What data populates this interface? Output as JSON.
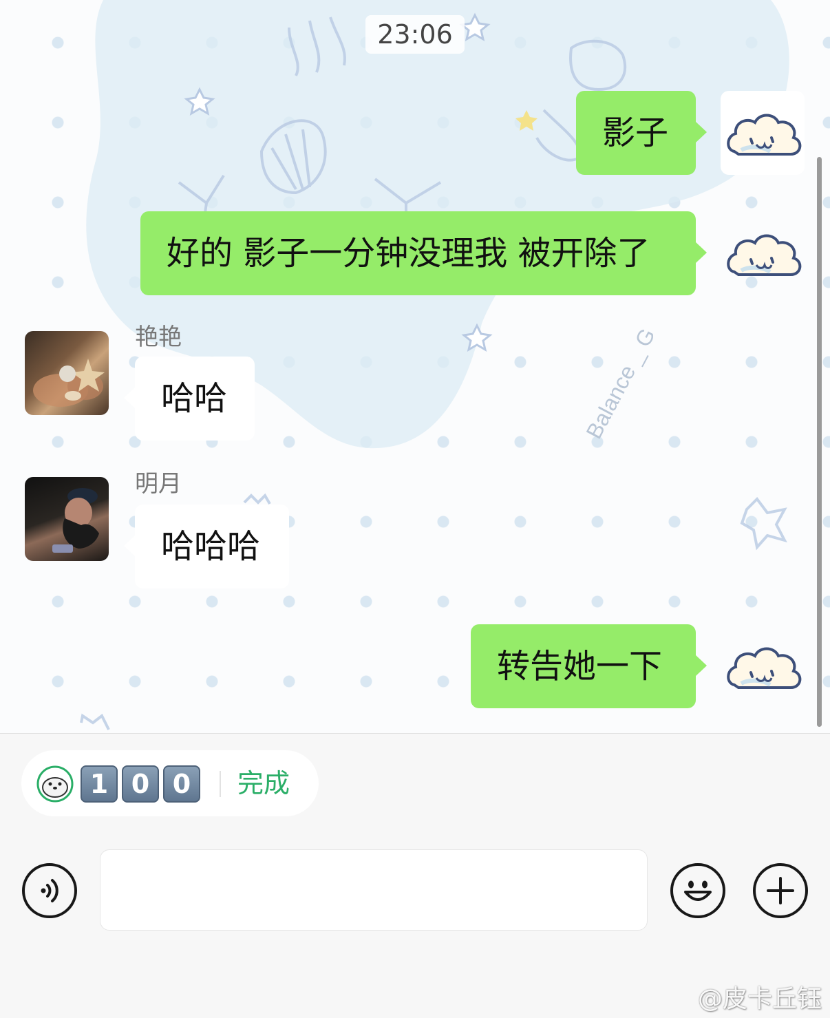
{
  "chat": {
    "timestamp": "23:06",
    "wallpaper_signature": "Balance _ G",
    "messages": [
      {
        "side": "me",
        "text": "影子",
        "avatar_icon": "cloud-face-icon"
      },
      {
        "side": "me",
        "text": "好的 影子一分钟没理我 被开除了",
        "avatar_icon": "cloud-face-icon"
      },
      {
        "side": "them",
        "sender": "艳艳",
        "text": "哈哈",
        "avatar_icon": "shells-photo-avatar"
      },
      {
        "side": "them",
        "sender": "明月",
        "text": "哈哈哈",
        "avatar_icon": "person-photo-avatar"
      },
      {
        "side": "me",
        "text": "转告她一下",
        "avatar_icon": "cloud-face-icon"
      }
    ]
  },
  "quick_reply": {
    "icon": "seal-icon",
    "digits": [
      "1",
      "0",
      "0"
    ],
    "done_label": "完成"
  },
  "input_bar": {
    "voice_icon": "voice-icon",
    "input_value": "",
    "emoji_icon": "emoji-icon",
    "plus_icon": "plus-icon"
  },
  "watermark": "@皮卡丘钰",
  "colors": {
    "my_bubble": "#95ec69",
    "their_bubble": "#ffffff",
    "done_green": "#2aae67"
  }
}
